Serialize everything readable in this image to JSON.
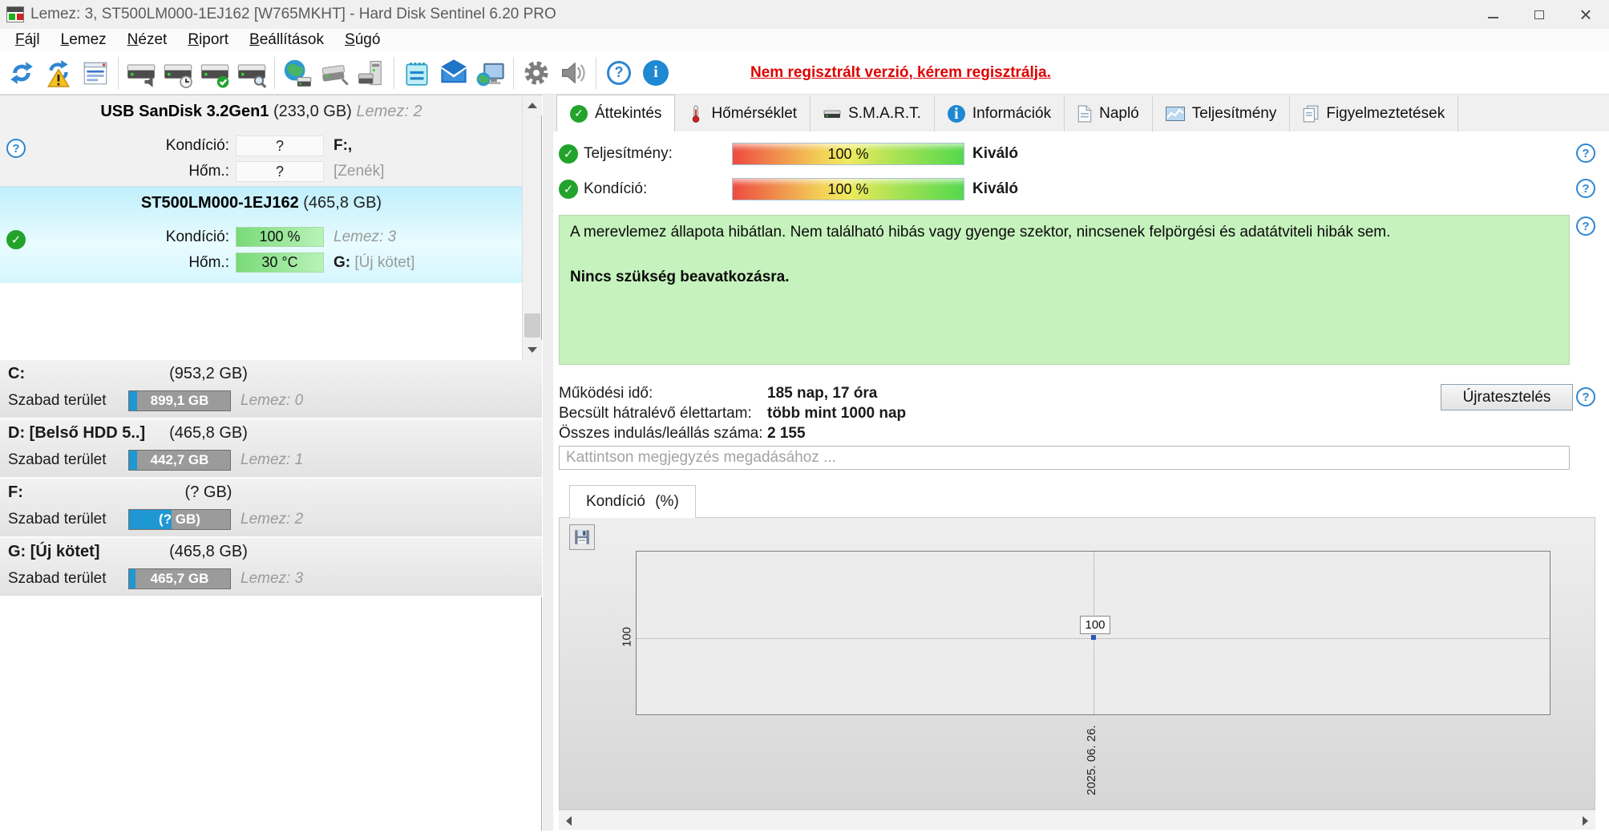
{
  "window": {
    "title": "Lemez: 3, ST500LM000-1EJ162 [W765MKHT] - Hard Disk Sentinel 6.20 PRO",
    "controls": [
      "minimize",
      "maximize",
      "close"
    ]
  },
  "menu": {
    "items": [
      "Fájl",
      "Lemez",
      "Nézet",
      "Riport",
      "Beállítások",
      "Súgó"
    ]
  },
  "toolbar": {
    "registration_notice": "Nem regisztrált verzió, kérem regisztrálja.",
    "icons": [
      "refresh",
      "refresh-warning",
      "report",
      "disk-acoustic",
      "disk-clock",
      "disk-check",
      "disk-surface-test",
      "network-disks",
      "disk-remove",
      "disk-computer",
      "notes",
      "email",
      "remote-monitor",
      "settings-gear",
      "sounds-speaker",
      "help",
      "information"
    ]
  },
  "left_panel": {
    "usb_device": {
      "name": "USB SanDisk 3.2Gen1",
      "size": "(233,0 GB)",
      "disk_label": "Lemez: 2",
      "condition_label": "Kondíció:",
      "condition_value": "?",
      "temp_label": "Hőm.:",
      "temp_value": "?",
      "drive_letter": "F:,",
      "volume_name": "[Zenék]"
    },
    "selected_disk": {
      "name": "ST500LM000-1EJ162",
      "size": "(465,8 GB)",
      "condition_label": "Kondíció:",
      "condition_value": "100 %",
      "disk_label": "Lemez: 3",
      "temp_label": "Hőm.:",
      "temp_value": "30 °C",
      "drive_letter": "G:",
      "volume_name": "[Új kötet]"
    },
    "free_space_label": "Szabad terület",
    "volumes": [
      {
        "name": "C:",
        "size": "(953,2 GB)",
        "free": "899,1 GB",
        "disk_label": "Lemez: 0",
        "used_pct": 8
      },
      {
        "name": "D: [Belső HDD 5..]",
        "size": "(465,8 GB)",
        "free": "442,7 GB",
        "disk_label": "Lemez: 1",
        "used_pct": 8
      },
      {
        "name": "F:",
        "size": "(? GB)",
        "free": "(? GB)",
        "disk_label": "Lemez: 2",
        "used_pct": 42
      },
      {
        "name": "G: [Új kötet]",
        "size": "(465,8 GB)",
        "free": "465,7 GB",
        "disk_label": "Lemez: 3",
        "used_pct": 6
      }
    ]
  },
  "tabs": [
    {
      "label": "Áttekintés",
      "icon": "check-circle",
      "active": true
    },
    {
      "label": "Hőmérséklet",
      "icon": "thermometer",
      "active": false
    },
    {
      "label": "S.M.A.R.T.",
      "icon": "disk",
      "active": false
    },
    {
      "label": "Információk",
      "icon": "info-circle",
      "active": false
    },
    {
      "label": "Napló",
      "icon": "document",
      "active": false
    },
    {
      "label": "Teljesítmény",
      "icon": "chart",
      "active": false
    },
    {
      "label": "Figyelmeztetések",
      "icon": "pages",
      "active": false
    }
  ],
  "overview": {
    "performance_label": "Teljesítmény:",
    "performance_value": "100 %",
    "performance_rating": "Kiváló",
    "condition_label": "Kondíció:",
    "condition_value": "100 %",
    "condition_rating": "Kiváló",
    "status_text": "A merevlemez állapota hibátlan. Nem található hibás vagy gyenge szektor, nincsenek felpörgési és adatátviteli hibák sem.",
    "status_action": "Nincs szükség beavatkozásra.",
    "stats": [
      {
        "label": "Működési idő:",
        "value": "185 nap, 17 óra"
      },
      {
        "label": "Becsült hátralévő élettartam:",
        "value": "több mint 1000 nap"
      },
      {
        "label": "Összes indulás/leállás száma:",
        "value": "2 155"
      }
    ],
    "retest_button": "Újratesztelés",
    "comment_placeholder": "Kattintson megjegyzés megadásához ..."
  },
  "chart": {
    "tab_label": "Kondíció (%)"
  },
  "chart_data": {
    "type": "line",
    "title": "Kondíció (%)",
    "x": [
      "2025. 06. 26."
    ],
    "values": [
      100
    ],
    "ytick_labels": [
      "100"
    ],
    "point_label": "100",
    "grid": "dotted",
    "legend": "none"
  },
  "colors": {
    "accent_blue": "#1f97d3",
    "selection_cyan": "#c0effc",
    "bar_green": "#8ce08c",
    "status_green_bg": "#c6f2bd",
    "free_bar_gray": "#9b9b9b",
    "registration_red": "#dd0000"
  }
}
